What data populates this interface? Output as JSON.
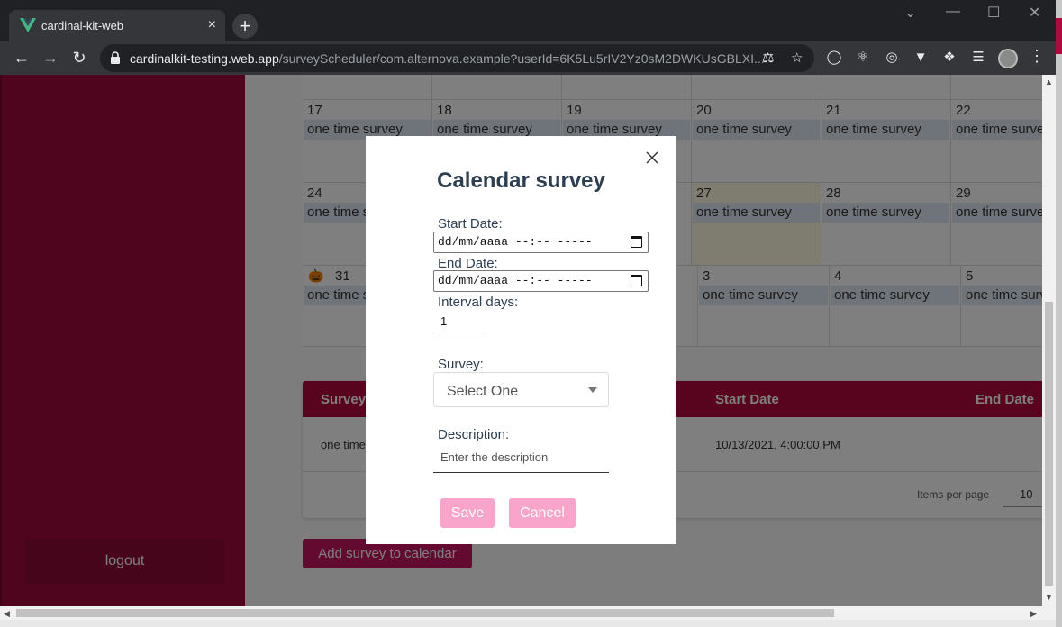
{
  "browser": {
    "tab_title": "cardinal-kit-web",
    "tab_close": "×",
    "new_tab": "+",
    "url_host": "cardinalkit-testing.web.app",
    "url_path": "/surveyScheduler/com.alternova.example?userId=6K5Lu5rIV2Yz0sM2DWKUsGBLXI..."
  },
  "sidebar": {
    "logout_label": "logout"
  },
  "calendar": {
    "rows": [
      [
        {
          "day": "17",
          "event": "one time survey"
        },
        {
          "day": "18",
          "event": "one time survey"
        },
        {
          "day": "19",
          "event": "one time survey"
        },
        {
          "day": "20",
          "event": "one time survey"
        },
        {
          "day": "21",
          "event": "one time survey"
        },
        {
          "day": "22",
          "event": "one time survey"
        }
      ],
      [
        {
          "day": "24",
          "event": "one time survey"
        },
        {
          "day": "",
          "event": ""
        },
        {
          "day": "",
          "event": ""
        },
        {
          "day": "27",
          "event": "one time survey"
        },
        {
          "day": "28",
          "event": "one time survey"
        },
        {
          "day": "29",
          "event": "one time survey"
        }
      ],
      [
        {
          "day": "31",
          "event": "one time survey"
        },
        {
          "day": "",
          "event": ""
        },
        {
          "day": "",
          "event": ""
        },
        {
          "day": "3",
          "event": "one time survey"
        },
        {
          "day": "4",
          "event": "one time survey"
        },
        {
          "day": "5",
          "event": "one time survey"
        }
      ]
    ]
  },
  "table": {
    "headers": [
      "Survey",
      "Start Date",
      "End Date"
    ],
    "row": {
      "survey": "one time",
      "start_date": "10/13/2021, 4:00:00 PM"
    },
    "items_per_page_label": "Items per page",
    "items_per_page_value": "10"
  },
  "add_survey_label": "Add survey to calendar",
  "modal": {
    "title": "Calendar survey",
    "start_date_label": "Start Date:",
    "start_date_value": "dd/mm/aaaa --:-- -----",
    "end_date_label": "End Date:",
    "end_date_value": "dd/mm/aaaa --:-- -----",
    "interval_label": "Interval days:",
    "interval_value": "1",
    "survey_label": "Survey:",
    "survey_value": "Select One",
    "description_label": "Description:",
    "description_placeholder": "Enter the description",
    "save_label": "Save",
    "cancel_label": "Cancel"
  },
  "colors": {
    "brand": "#b0093f",
    "sidebar": "#9c0a3a",
    "button_pink": "#f8a4cb",
    "event_bg": "#dfe6f5"
  }
}
